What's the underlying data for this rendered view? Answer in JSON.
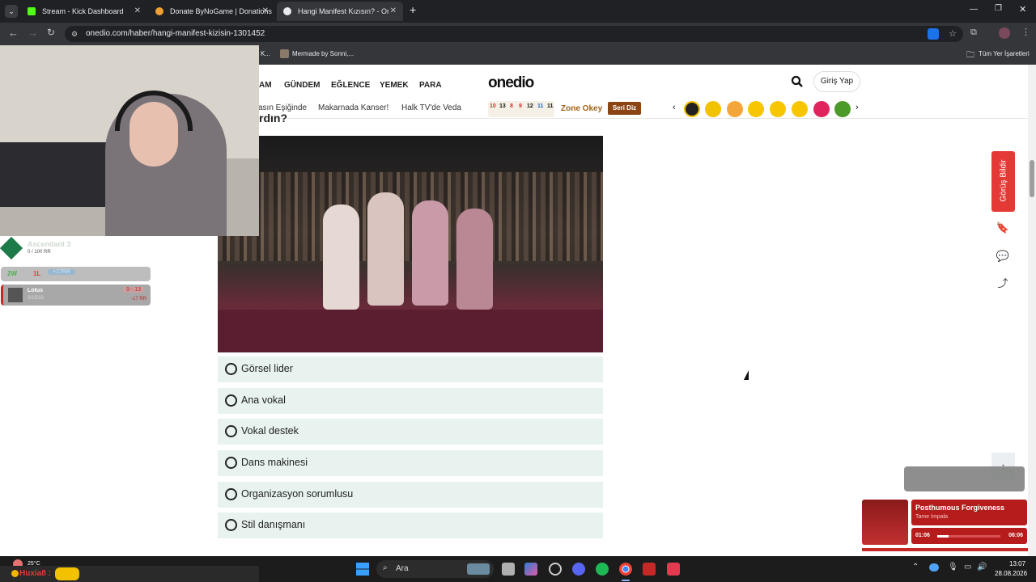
{
  "browser": {
    "tabs": [
      {
        "title": "Stream - Kick Dashboard",
        "color": "#53fc18"
      },
      {
        "title": "Donate ByNoGame | Donations",
        "color": "#f0a030"
      },
      {
        "title": "Hangi Manifest Kızısın? - Oned",
        "color": "#e8eaed"
      }
    ],
    "new_tab": "+",
    "url": "onedio.com/haber/hangi-manifest-kizisin-1301452",
    "bookmarks": [
      {
        "label": "K..."
      },
      {
        "label": "Mermade by Sonni,..."
      },
      {
        "label": "Tüm Yer İşaretleri"
      }
    ]
  },
  "site": {
    "logo": "onedio",
    "nav": [
      "AM",
      "GÜNDEM",
      "EĞLENCE",
      "YEMEK",
      "PARA"
    ],
    "login_label": "Giriş Yap",
    "tags": [
      "asın Eşiğinde",
      "Makarnada Kanser!",
      "Halk TV'de Veda"
    ],
    "zone_okey": "Zone Okey",
    "seri_diz": "Seri Diz",
    "okey_numbers": [
      "10",
      "13",
      "8",
      "9",
      "12",
      "11",
      "11"
    ],
    "question_fragment": "rdın?",
    "feedback_label": "Görüş Bildir",
    "answers": [
      "Görsel lider",
      "Ana vokal",
      "Vokal destek",
      "Dans makinesi",
      "Organizasyon sorumlusu",
      "Stil danışmanı"
    ]
  },
  "overlay": {
    "rank": "Ascendant 3",
    "rr": "0 / 100 RR",
    "record_win": "2W",
    "record_loss": "1L",
    "record_rr": "+17RR",
    "last_map": "Lotus",
    "last_score": "9 - 13",
    "last_rr": "-17 RR",
    "player_sub": "3/15/10",
    "chat_user": "Huxia8 :"
  },
  "music": {
    "title": "Posthumous Forgiveness",
    "artist": "Tame Impala",
    "elapsed": "01:06",
    "duration": "06:06",
    "progress": 0.18
  },
  "taskbar": {
    "temp": "25°C",
    "search_label": "Ara",
    "time": "13:07",
    "date": "28.08.2026"
  }
}
